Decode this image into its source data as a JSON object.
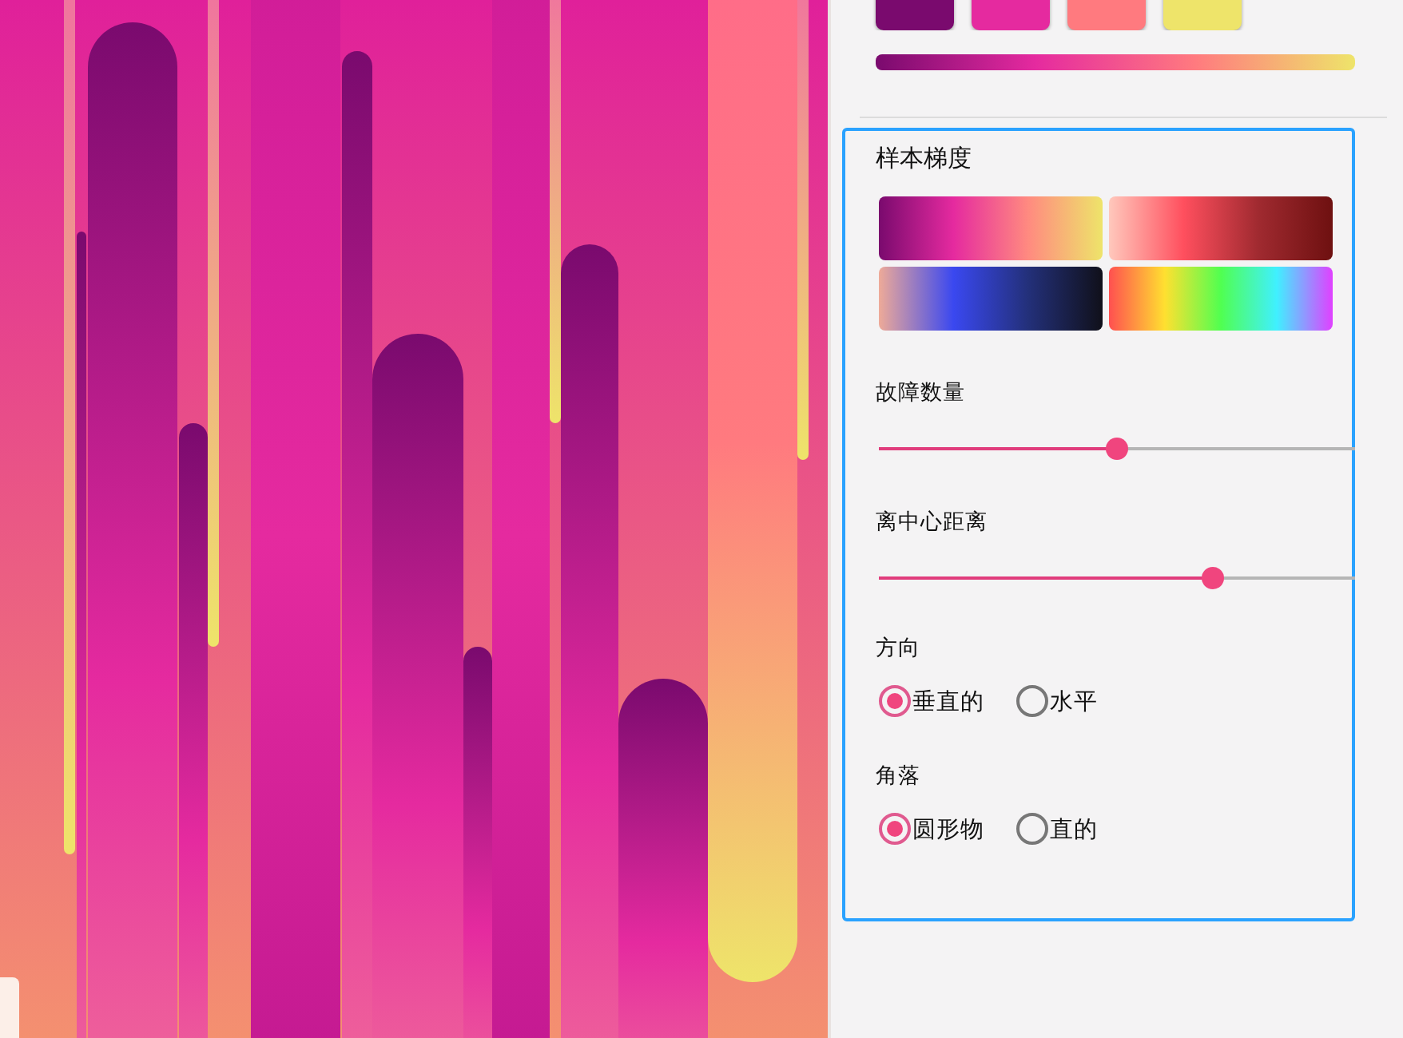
{
  "palette": {
    "swatches": [
      {
        "color": "#7a0a6e"
      },
      {
        "color": "#e52a9f"
      },
      {
        "color": "#ff7a7f"
      },
      {
        "color": "#eee46a"
      }
    ]
  },
  "settings": {
    "sample_gradients": {
      "title": "样本梯度"
    },
    "glitch_count": {
      "label": "故障数量",
      "level": 0.5
    },
    "distance_from_center": {
      "label": "离中心距离",
      "level": 0.7
    },
    "direction": {
      "label": "方向",
      "options": [
        {
          "label": "垂直的",
          "selected": true
        },
        {
          "label": "水平",
          "selected": false
        }
      ]
    },
    "corners": {
      "label": "角落",
      "options": [
        {
          "label": "圆形物",
          "selected": true
        },
        {
          "label": "直的",
          "selected": false
        }
      ]
    }
  }
}
